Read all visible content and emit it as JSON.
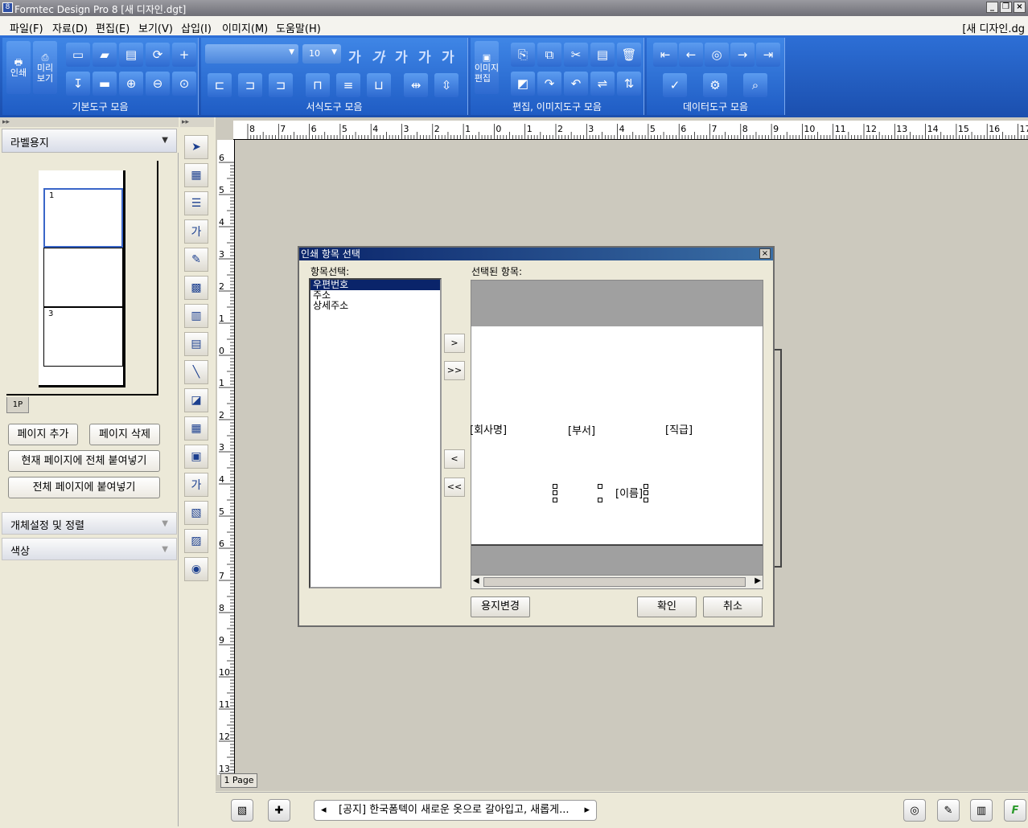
{
  "window": {
    "title": "Formtec Design Pro 8 [새 디자인.dgt]",
    "app_icon": "8",
    "min": "_",
    "restore": "❐",
    "close": "×"
  },
  "menu": [
    "파일(F)",
    "자료(D)",
    "편집(E)",
    "보기(V)",
    "삽입(I)",
    "이미지(M)",
    "도움말(H)"
  ],
  "doc_name": "[새 디자인.dg",
  "ribbon": {
    "groups": [
      "기본도구 모음",
      "서식도구 모음",
      "편집, 이미지도구 모음",
      "데이터도구 모음"
    ],
    "print_label": "인쇄",
    "preview_label": "미리\n보기",
    "font_size": "10",
    "font_glyph": "가",
    "image_edit_label": "이미지\n편집"
  },
  "left": {
    "collapse": "▸▸",
    "title": "라벨용지",
    "cells": [
      "1",
      "",
      "3"
    ],
    "page_tab": "1P",
    "buttons": {
      "add": "페이지 추가",
      "delete": "페이지 삭제",
      "paste_current": "현재 페이지에 전체 붙여넣기",
      "paste_all": "전체 페이지에 붙여넣기"
    },
    "panels": [
      "개체설정 및 정렬",
      "색상"
    ]
  },
  "canvas": {
    "page_label": "1 Page"
  },
  "bottom": {
    "news": "[공지] 한국폼텍이 새로운 옷으로 갈아입고, 새롭게..."
  },
  "dialog": {
    "title": "인쇄 항목 선택",
    "close": "×",
    "left_label": "항목선택:",
    "right_label": "선택된 항목:",
    "items": [
      "우편번호",
      "주소",
      "상세주소"
    ],
    "selected_index": 0,
    "move_buttons": [
      ">",
      ">>",
      "<",
      "<<"
    ],
    "fields": [
      "[회사명]",
      "[부서]",
      "[직급]",
      "[이름]"
    ],
    "change_paper": "용지변경",
    "ok": "확인",
    "cancel": "취소"
  }
}
